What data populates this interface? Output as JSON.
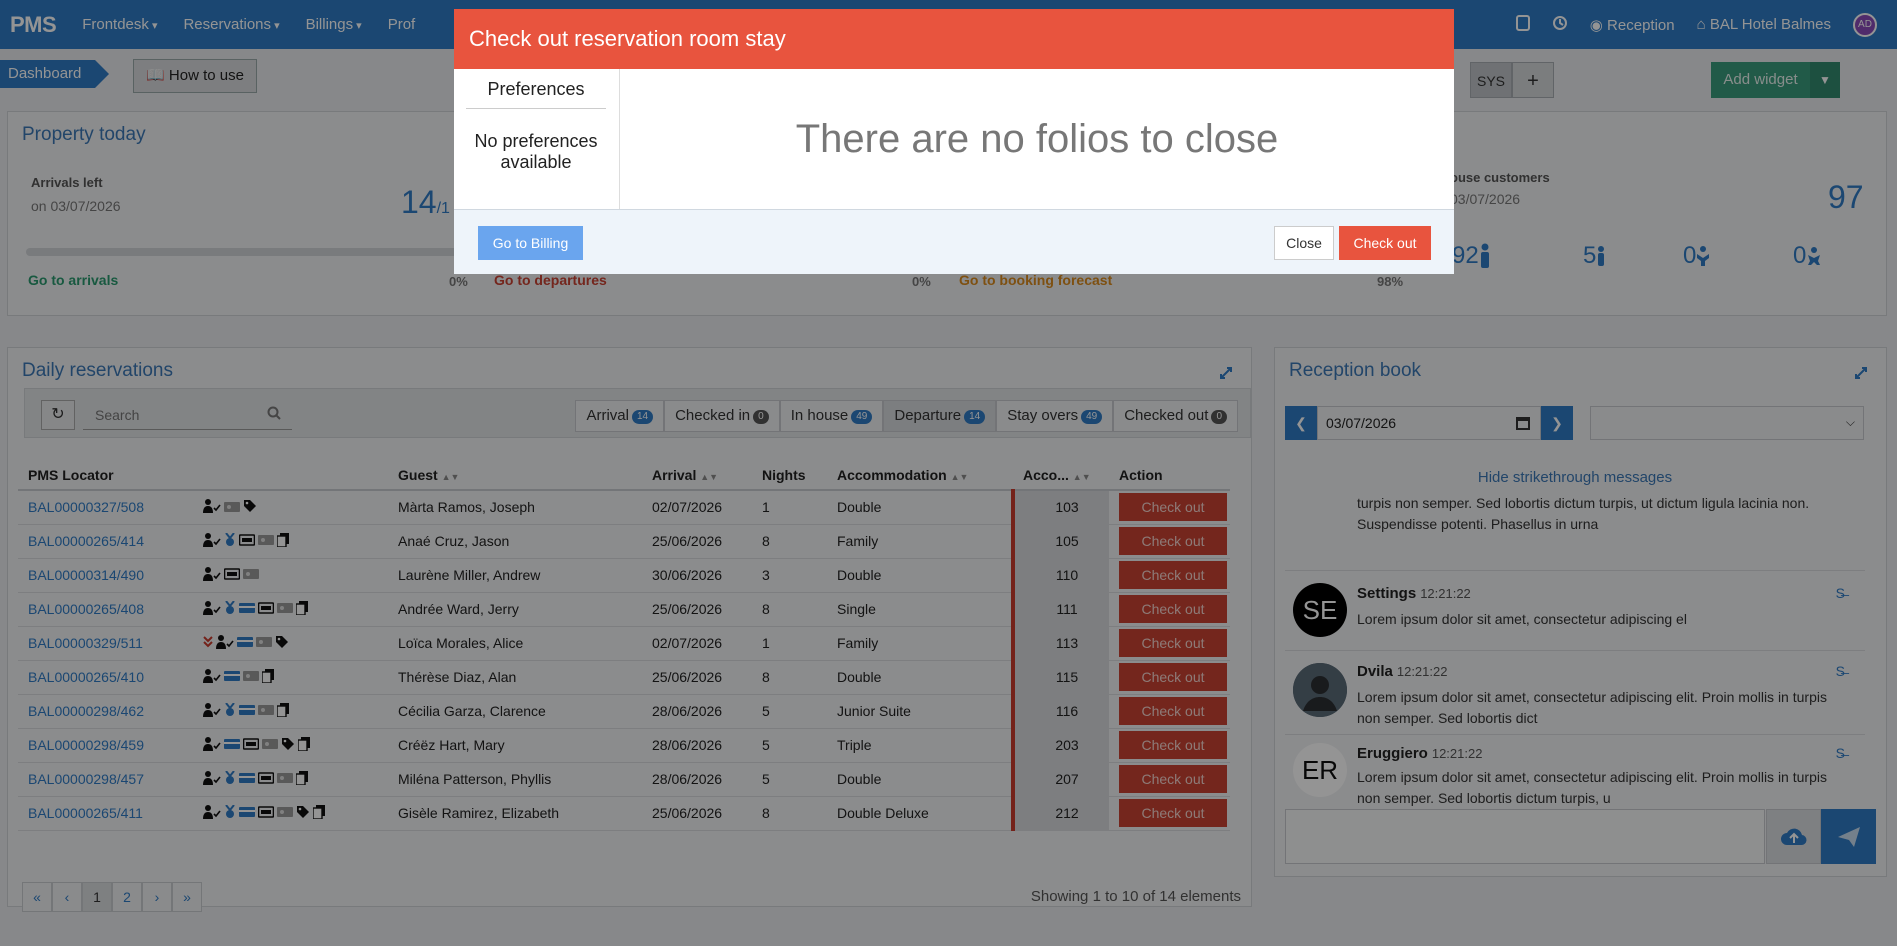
{
  "nav": {
    "logo": "PMS",
    "menus": [
      "Frontdesk",
      "Reservations",
      "Billings",
      "Prof"
    ],
    "reception": "Reception",
    "hotel": "BAL Hotel Balmes",
    "avatar": "AD"
  },
  "breadcrumb": "Dashboard",
  "how_to_use": "How to use",
  "sys_label": "SYS",
  "add_widget": "Add widget",
  "property_today": {
    "title": "Property today",
    "arrivals_label": "Arrivals left",
    "arrivals_date": "on 03/07/2026",
    "arrivals_count": "14",
    "arrivals_total": "/1",
    "go_arrivals": "Go to arrivals",
    "arrivals_pct": "0%",
    "go_departures": "Go to departures",
    "departures_pct": "0%",
    "go_forecast": "Go to booking forecast",
    "forecast_pct": "98%",
    "house_label": "ouse customers",
    "house_date": "03/07/2026",
    "house_total": "97",
    "adults": "92",
    "children": "5",
    "juniors": "0",
    "babies": "0"
  },
  "daily": {
    "title": "Daily reservations",
    "search_placeholder": "Search",
    "tabs": [
      {
        "label": "Arrival",
        "count": "14"
      },
      {
        "label": "Checked in",
        "count": "0"
      },
      {
        "label": "In house",
        "count": "49"
      },
      {
        "label": "Departure",
        "count": "14"
      },
      {
        "label": "Stay overs",
        "count": "49"
      },
      {
        "label": "Checked out",
        "count": "0"
      }
    ],
    "columns": [
      "PMS Locator",
      "Guest",
      "Arrival",
      "Nights",
      "Accommodation",
      "Acco...",
      "Action"
    ],
    "action_label": "Check out",
    "rows": [
      {
        "loc": "BAL00000327/508",
        "guest": "Màrta Ramos, Joseph",
        "arrival": "02/07/2026",
        "nights": "1",
        "acc": "Double",
        "room": "103"
      },
      {
        "loc": "BAL00000265/414",
        "guest": "Anaé Cruz, Jason",
        "arrival": "25/06/2026",
        "nights": "8",
        "acc": "Family",
        "room": "105"
      },
      {
        "loc": "BAL00000314/490",
        "guest": "Laurène Miller, Andrew",
        "arrival": "30/06/2026",
        "nights": "3",
        "acc": "Double",
        "room": "110"
      },
      {
        "loc": "BAL00000265/408",
        "guest": "Andrée Ward, Jerry",
        "arrival": "25/06/2026",
        "nights": "8",
        "acc": "Single",
        "room": "111"
      },
      {
        "loc": "BAL00000329/511",
        "guest": "Loïca Morales, Alice",
        "arrival": "02/07/2026",
        "nights": "1",
        "acc": "Family",
        "room": "113"
      },
      {
        "loc": "BAL00000265/410",
        "guest": "Thérèse Diaz, Alan",
        "arrival": "25/06/2026",
        "nights": "8",
        "acc": "Double",
        "room": "115"
      },
      {
        "loc": "BAL00000298/462",
        "guest": "Cécilia Garza, Clarence",
        "arrival": "28/06/2026",
        "nights": "5",
        "acc": "Junior Suite",
        "room": "116"
      },
      {
        "loc": "BAL00000298/459",
        "guest": "Créëz Hart, Mary",
        "arrival": "28/06/2026",
        "nights": "5",
        "acc": "Triple",
        "room": "203"
      },
      {
        "loc": "BAL00000298/457",
        "guest": "Miléna Patterson, Phyllis",
        "arrival": "28/06/2026",
        "nights": "5",
        "acc": "Double",
        "room": "207"
      },
      {
        "loc": "BAL00000265/411",
        "guest": "Gisèle Ramirez, Elizabeth",
        "arrival": "25/06/2026",
        "nights": "8",
        "acc": "Double Deluxe",
        "room": "212"
      }
    ],
    "pager": [
      "«",
      "‹",
      "1",
      "2",
      "›",
      "»"
    ],
    "showing": "Showing 1 to 10 of 14 elements"
  },
  "reception_book": {
    "title": "Reception book",
    "date": "03/07/2026",
    "hide_msg": "Hide strikethrough messages",
    "messages": [
      {
        "who": "",
        "time": "",
        "text": "turpis non semper. Sed lobortis dictum turpis, ut dictum ligula lacinia non. Suspendisse potenti. Phasellus in urna"
      },
      {
        "who": "Settings",
        "time": "12:21:22",
        "initials": "SE",
        "text": "Lorem ipsum dolor sit amet, consectetur adipiscing el"
      },
      {
        "who": "Dvila",
        "time": "12:21:22",
        "text": "Lorem ipsum dolor sit amet, consectetur adipiscing elit. Proin mollis in turpis non semper. Sed lobortis dict"
      },
      {
        "who": "Eruggiero",
        "time": "12:21:22",
        "initials": "ER",
        "text": "Lorem ipsum dolor sit amet, consectetur adipiscing elit. Proin mollis in turpis non semper. Sed lobortis dictum turpis, u"
      }
    ]
  },
  "modal": {
    "title": "Check out reservation room stay",
    "pref_title": "Preferences",
    "pref_none": "No preferences available",
    "no_folios": "There are no folios to close",
    "go_billing": "Go to Billing",
    "close": "Close",
    "checkout": "Check out"
  },
  "colors": {
    "primary": "#2f7bc4",
    "danger": "#e8543e",
    "success": "#3a9b7d"
  }
}
